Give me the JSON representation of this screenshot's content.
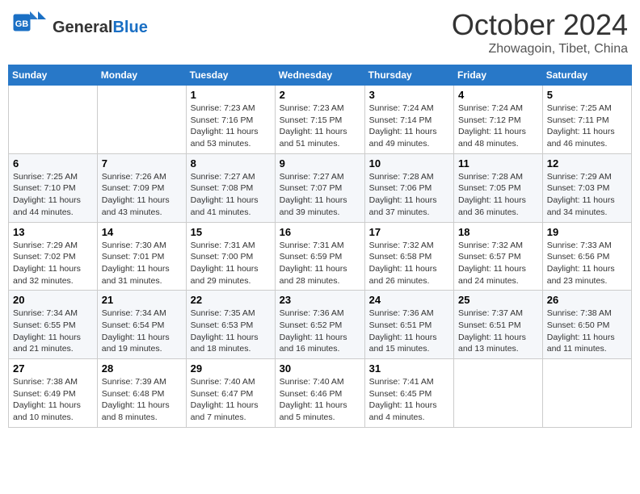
{
  "header": {
    "logo_general": "General",
    "logo_blue": "Blue",
    "title": "October 2024",
    "location": "Zhowagoin, Tibet, China"
  },
  "days_of_week": [
    "Sunday",
    "Monday",
    "Tuesday",
    "Wednesday",
    "Thursday",
    "Friday",
    "Saturday"
  ],
  "weeks": [
    [
      {
        "day": "",
        "content": ""
      },
      {
        "day": "",
        "content": ""
      },
      {
        "day": "1",
        "content": "Sunrise: 7:23 AM\nSunset: 7:16 PM\nDaylight: 11 hours and 53 minutes."
      },
      {
        "day": "2",
        "content": "Sunrise: 7:23 AM\nSunset: 7:15 PM\nDaylight: 11 hours and 51 minutes."
      },
      {
        "day": "3",
        "content": "Sunrise: 7:24 AM\nSunset: 7:14 PM\nDaylight: 11 hours and 49 minutes."
      },
      {
        "day": "4",
        "content": "Sunrise: 7:24 AM\nSunset: 7:12 PM\nDaylight: 11 hours and 48 minutes."
      },
      {
        "day": "5",
        "content": "Sunrise: 7:25 AM\nSunset: 7:11 PM\nDaylight: 11 hours and 46 minutes."
      }
    ],
    [
      {
        "day": "6",
        "content": "Sunrise: 7:25 AM\nSunset: 7:10 PM\nDaylight: 11 hours and 44 minutes."
      },
      {
        "day": "7",
        "content": "Sunrise: 7:26 AM\nSunset: 7:09 PM\nDaylight: 11 hours and 43 minutes."
      },
      {
        "day": "8",
        "content": "Sunrise: 7:27 AM\nSunset: 7:08 PM\nDaylight: 11 hours and 41 minutes."
      },
      {
        "day": "9",
        "content": "Sunrise: 7:27 AM\nSunset: 7:07 PM\nDaylight: 11 hours and 39 minutes."
      },
      {
        "day": "10",
        "content": "Sunrise: 7:28 AM\nSunset: 7:06 PM\nDaylight: 11 hours and 37 minutes."
      },
      {
        "day": "11",
        "content": "Sunrise: 7:28 AM\nSunset: 7:05 PM\nDaylight: 11 hours and 36 minutes."
      },
      {
        "day": "12",
        "content": "Sunrise: 7:29 AM\nSunset: 7:03 PM\nDaylight: 11 hours and 34 minutes."
      }
    ],
    [
      {
        "day": "13",
        "content": "Sunrise: 7:29 AM\nSunset: 7:02 PM\nDaylight: 11 hours and 32 minutes."
      },
      {
        "day": "14",
        "content": "Sunrise: 7:30 AM\nSunset: 7:01 PM\nDaylight: 11 hours and 31 minutes."
      },
      {
        "day": "15",
        "content": "Sunrise: 7:31 AM\nSunset: 7:00 PM\nDaylight: 11 hours and 29 minutes."
      },
      {
        "day": "16",
        "content": "Sunrise: 7:31 AM\nSunset: 6:59 PM\nDaylight: 11 hours and 28 minutes."
      },
      {
        "day": "17",
        "content": "Sunrise: 7:32 AM\nSunset: 6:58 PM\nDaylight: 11 hours and 26 minutes."
      },
      {
        "day": "18",
        "content": "Sunrise: 7:32 AM\nSunset: 6:57 PM\nDaylight: 11 hours and 24 minutes."
      },
      {
        "day": "19",
        "content": "Sunrise: 7:33 AM\nSunset: 6:56 PM\nDaylight: 11 hours and 23 minutes."
      }
    ],
    [
      {
        "day": "20",
        "content": "Sunrise: 7:34 AM\nSunset: 6:55 PM\nDaylight: 11 hours and 21 minutes."
      },
      {
        "day": "21",
        "content": "Sunrise: 7:34 AM\nSunset: 6:54 PM\nDaylight: 11 hours and 19 minutes."
      },
      {
        "day": "22",
        "content": "Sunrise: 7:35 AM\nSunset: 6:53 PM\nDaylight: 11 hours and 18 minutes."
      },
      {
        "day": "23",
        "content": "Sunrise: 7:36 AM\nSunset: 6:52 PM\nDaylight: 11 hours and 16 minutes."
      },
      {
        "day": "24",
        "content": "Sunrise: 7:36 AM\nSunset: 6:51 PM\nDaylight: 11 hours and 15 minutes."
      },
      {
        "day": "25",
        "content": "Sunrise: 7:37 AM\nSunset: 6:51 PM\nDaylight: 11 hours and 13 minutes."
      },
      {
        "day": "26",
        "content": "Sunrise: 7:38 AM\nSunset: 6:50 PM\nDaylight: 11 hours and 11 minutes."
      }
    ],
    [
      {
        "day": "27",
        "content": "Sunrise: 7:38 AM\nSunset: 6:49 PM\nDaylight: 11 hours and 10 minutes."
      },
      {
        "day": "28",
        "content": "Sunrise: 7:39 AM\nSunset: 6:48 PM\nDaylight: 11 hours and 8 minutes."
      },
      {
        "day": "29",
        "content": "Sunrise: 7:40 AM\nSunset: 6:47 PM\nDaylight: 11 hours and 7 minutes."
      },
      {
        "day": "30",
        "content": "Sunrise: 7:40 AM\nSunset: 6:46 PM\nDaylight: 11 hours and 5 minutes."
      },
      {
        "day": "31",
        "content": "Sunrise: 7:41 AM\nSunset: 6:45 PM\nDaylight: 11 hours and 4 minutes."
      },
      {
        "day": "",
        "content": ""
      },
      {
        "day": "",
        "content": ""
      }
    ]
  ]
}
